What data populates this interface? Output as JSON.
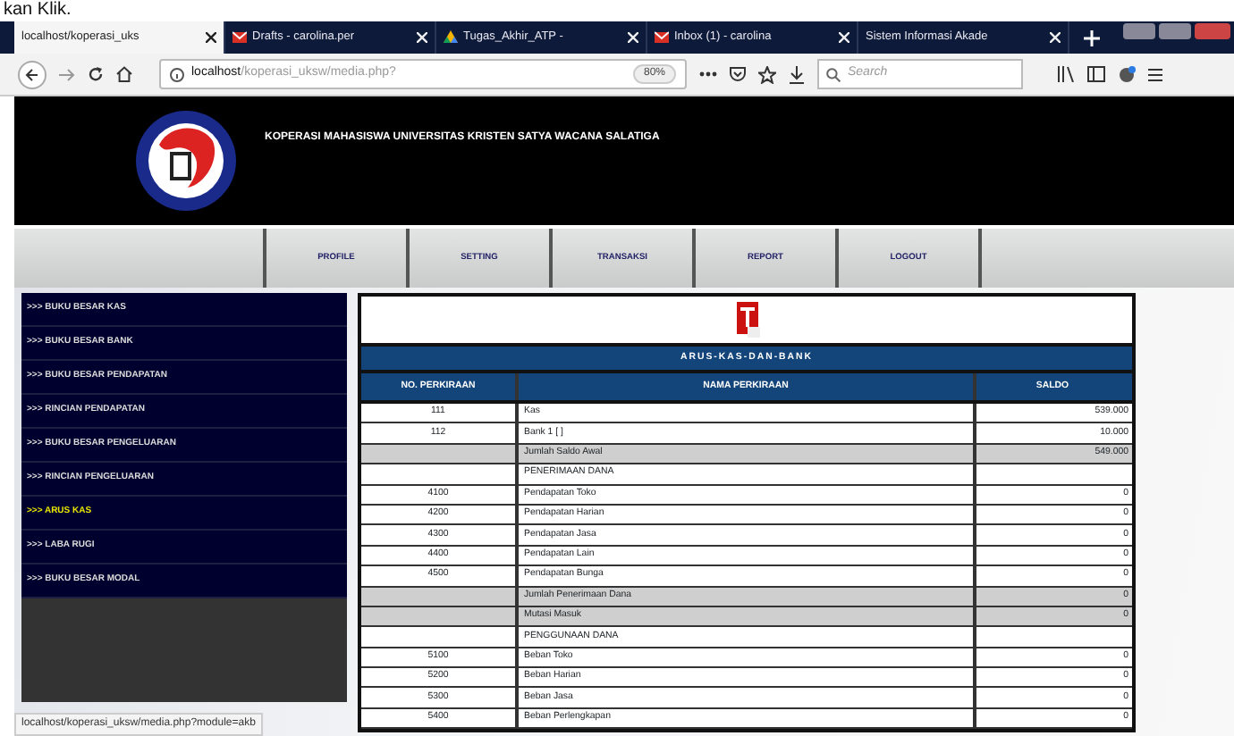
{
  "caption": "kan Klik.",
  "browser": {
    "tabs": [
      {
        "label": "localhost/koperasi_uks",
        "selected": true,
        "kind": "plain"
      },
      {
        "label": "Drafts - carolina.per",
        "selected": false,
        "kind": "mail"
      },
      {
        "label": "Tugas_Akhir_ATP -",
        "selected": false,
        "kind": "drive"
      },
      {
        "label": "Inbox (1) - carolina",
        "selected": false,
        "kind": "mail"
      },
      {
        "label": "Sistem Informasi Akade",
        "selected": false,
        "kind": "plain"
      }
    ],
    "url_host": "localhost",
    "url_path": "/koperasi_uksw/media.php?",
    "zoom": "80%",
    "search_placeholder": "Search"
  },
  "header": {
    "title": "KOPERASI MAHASISWA UNIVERSITAS KRISTEN SATYA WACANA SALATIGA"
  },
  "nav": [
    "PROFILE",
    "SETTING",
    "TRANSAKSI",
    "REPORT",
    "LOGOUT"
  ],
  "sidebar": [
    {
      "label": ">>> BUKU BESAR KAS",
      "selected": false
    },
    {
      "label": ">>> BUKU BESAR BANK",
      "selected": false
    },
    {
      "label": ">>> BUKU BESAR PENDAPATAN",
      "selected": false
    },
    {
      "label": ">>> RINCIAN PENDAPATAN",
      "selected": false
    },
    {
      "label": ">>> BUKU BESAR PENGELUARAN",
      "selected": false
    },
    {
      "label": ">>> RINCIAN PENGELUARAN",
      "selected": false
    },
    {
      "label": ">>> ARUS KAS",
      "selected": true
    },
    {
      "label": ">>> LABA RUGI",
      "selected": false
    },
    {
      "label": ">>> BUKU BESAR MODAL",
      "selected": false
    }
  ],
  "report": {
    "title": "ARUS-KAS-DAN-BANK",
    "columns": [
      "NO. PERKIRAAN",
      "NAMA PERKIRAAN",
      "SALDO"
    ],
    "rows": [
      {
        "kind": "item",
        "code": "111",
        "name": "Kas",
        "amount": "539.000"
      },
      {
        "kind": "item",
        "code": "112",
        "name": "Bank 1 [ ]",
        "amount": "10.000"
      },
      {
        "kind": "total",
        "name": "Jumlah Saldo Awal",
        "amount": "549.000"
      },
      {
        "kind": "section",
        "name": "PENERIMAAN DANA"
      },
      {
        "kind": "item",
        "code": "4100",
        "name": "Pendapatan Toko",
        "amount": "0"
      },
      {
        "kind": "item",
        "code": "4200",
        "name": "Pendapatan Harian",
        "amount": "0"
      },
      {
        "kind": "item",
        "code": "4300",
        "name": "Pendapatan Jasa",
        "amount": "0"
      },
      {
        "kind": "item",
        "code": "4400",
        "name": "Pendapatan Lain",
        "amount": "0"
      },
      {
        "kind": "item",
        "code": "4500",
        "name": "Pendapatan Bunga",
        "amount": "0"
      },
      {
        "kind": "total",
        "name": "Jumlah Penerimaan Dana",
        "amount": "0"
      },
      {
        "kind": "total",
        "name": "Mutasi Masuk",
        "amount": "0"
      },
      {
        "kind": "section",
        "name": "PENGGUNAAN DANA"
      },
      {
        "kind": "item",
        "code": "5100",
        "name": "Beban Toko",
        "amount": "0"
      },
      {
        "kind": "item",
        "code": "5200",
        "name": "Beban Harian",
        "amount": "0"
      },
      {
        "kind": "item",
        "code": "5300",
        "name": "Beban Jasa",
        "amount": "0"
      },
      {
        "kind": "item",
        "code": "5400",
        "name": "Beban Perlengkapan",
        "amount": "0"
      }
    ]
  },
  "status_bar": "localhost/koperasi_uksw/media.php?module=akb"
}
